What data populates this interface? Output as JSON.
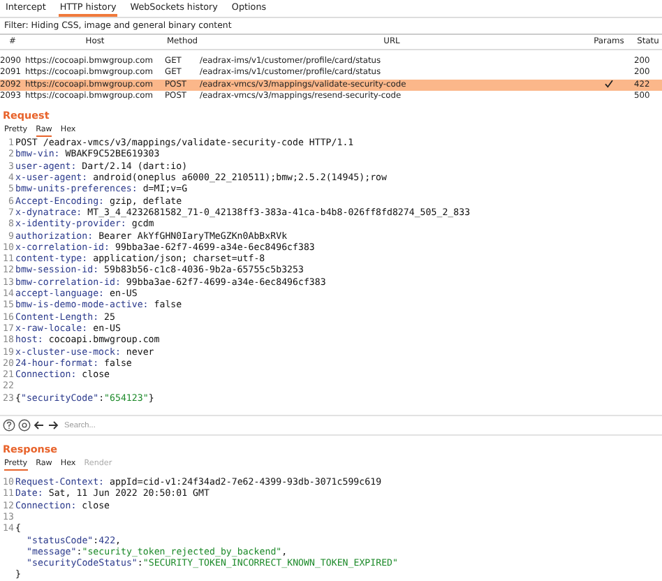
{
  "top_tabs": [
    {
      "label": "Intercept",
      "selected": false
    },
    {
      "label": "HTTP history",
      "selected": true
    },
    {
      "label": "WebSockets history",
      "selected": false
    },
    {
      "label": "Options",
      "selected": false
    }
  ],
  "filter": "Filter: Hiding CSS, image and general binary content",
  "table": {
    "columns": [
      "#",
      "Host",
      "Method",
      "URL",
      "Params",
      "Statu"
    ],
    "rows": [
      {
        "num": "2090",
        "host": "https://cocoapi.bmwgroup.com",
        "method": "GET",
        "url": "/eadrax-ims/v1/customer/profile/card/status",
        "params": false,
        "status": "200",
        "selected": false
      },
      {
        "num": "2091",
        "host": "https://cocoapi.bmwgroup.com",
        "method": "GET",
        "url": "/eadrax-ims/v1/customer/profile/card/status",
        "params": false,
        "status": "200",
        "selected": false
      },
      {
        "num": "2092",
        "host": "https://cocoapi.bmwgroup.com",
        "method": "POST",
        "url": "/eadrax-vmcs/v3/mappings/validate-security-code",
        "params": true,
        "status": "422",
        "selected": true
      },
      {
        "num": "2093",
        "host": "https://cocoapi.bmwgroup.com",
        "method": "POST",
        "url": "/eadrax-vmcs/v3/mappings/resend-security-code",
        "params": false,
        "status": "500",
        "selected": false
      }
    ]
  },
  "request": {
    "title": "Request",
    "tabs": [
      {
        "label": "Pretty",
        "selected": false,
        "disabled": false
      },
      {
        "label": "Raw",
        "selected": true,
        "disabled": false
      },
      {
        "label": "Hex",
        "selected": false,
        "disabled": false
      }
    ],
    "lines": [
      {
        "n": "1",
        "kind": "plain",
        "text": "POST /eadrax-vmcs/v3/mappings/validate-security-code HTTP/1.1"
      },
      {
        "n": "2",
        "kind": "header",
        "name": "bmw-vin:",
        "value": "WBAKF9C52BE619303"
      },
      {
        "n": "3",
        "kind": "header",
        "name": "user-agent:",
        "value": "Dart/2.14 (dart:io)"
      },
      {
        "n": "4",
        "kind": "header",
        "name": "x-user-agent:",
        "value": "android(oneplus a6000_22_210511);bmw;2.5.2(14945);row"
      },
      {
        "n": "5",
        "kind": "header",
        "name": "bmw-units-preferences:",
        "value": "d=MI;v=G"
      },
      {
        "n": "6",
        "kind": "header",
        "name": "Accept-Encoding:",
        "value": "gzip, deflate"
      },
      {
        "n": "7",
        "kind": "header",
        "name": "x-dynatrace:",
        "value": "MT_3_4_4232681582_71-0_42138ff3-383a-41ca-b4b8-026ff8fd8274_505_2_833"
      },
      {
        "n": "8",
        "kind": "header",
        "name": "x-identity-provider:",
        "value": "gcdm"
      },
      {
        "n": "9",
        "kind": "header",
        "name": "authorization:",
        "value": "Bearer AkYfGHN0IaryTMeGZKn0AbBxRVk"
      },
      {
        "n": "10",
        "kind": "header",
        "name": "x-correlation-id:",
        "value": "99bba3ae-62f7-4699-a34e-6ec8496cf383"
      },
      {
        "n": "11",
        "kind": "header",
        "name": "content-type:",
        "value": "application/json; charset=utf-8"
      },
      {
        "n": "12",
        "kind": "header",
        "name": "bmw-session-id:",
        "value": "59b83b56-c1c8-4036-9b2a-65755c5b3253"
      },
      {
        "n": "13",
        "kind": "header",
        "name": "bmw-correlation-id:",
        "value": "99bba3ae-62f7-4699-a34e-6ec8496cf383"
      },
      {
        "n": "14",
        "kind": "header",
        "name": "accept-language:",
        "value": "en-US"
      },
      {
        "n": "15",
        "kind": "header",
        "name": "bmw-is-demo-mode-active:",
        "value": "false"
      },
      {
        "n": "16",
        "kind": "header",
        "name": "Content-Length:",
        "value": "25"
      },
      {
        "n": "17",
        "kind": "header",
        "name": "x-raw-locale:",
        "value": "en-US"
      },
      {
        "n": "18",
        "kind": "header",
        "name": "host:",
        "value": "cocoapi.bmwgroup.com"
      },
      {
        "n": "19",
        "kind": "header",
        "name": "x-cluster-use-mock:",
        "value": "never"
      },
      {
        "n": "20",
        "kind": "header",
        "name": "24-hour-format:",
        "value": "false"
      },
      {
        "n": "21",
        "kind": "header",
        "name": "Connection:",
        "value": "close"
      },
      {
        "n": "22",
        "kind": "empty"
      },
      {
        "n": "23",
        "kind": "body",
        "tokens": [
          {
            "kind": "punct",
            "text": "{"
          },
          {
            "kind": "key",
            "text": "\"securityCode\""
          },
          {
            "kind": "punct",
            "text": ":"
          },
          {
            "kind": "string",
            "text": "\"654123\""
          },
          {
            "kind": "punct",
            "text": "}"
          }
        ]
      }
    ]
  },
  "search": {
    "placeholder": "Search..."
  },
  "response": {
    "title": "Response",
    "tabs": [
      {
        "label": "Pretty",
        "selected": true,
        "disabled": false
      },
      {
        "label": "Raw",
        "selected": false,
        "disabled": false
      },
      {
        "label": "Hex",
        "selected": false,
        "disabled": false
      },
      {
        "label": "Render",
        "selected": false,
        "disabled": true
      }
    ],
    "lines": [
      {
        "n": "10",
        "kind": "header",
        "name": "Request-Context:",
        "value": "appId=cid-v1:24f34ad2-7e62-4399-93db-3071c599c619"
      },
      {
        "n": "11",
        "kind": "header",
        "name": "Date:",
        "value": "Sat, 11 Jun 2022 20:50:01 GMT"
      },
      {
        "n": "12",
        "kind": "header",
        "name": "Connection:",
        "value": "close"
      },
      {
        "n": "13",
        "kind": "empty"
      },
      {
        "n": "14",
        "kind": "body",
        "tokens": [
          {
            "kind": "punct",
            "text": "{"
          }
        ]
      },
      {
        "kind": "nested",
        "tokens": [
          {
            "kind": "key",
            "text": "\"statusCode\""
          },
          {
            "kind": "punct",
            "text": ":"
          },
          {
            "kind": "number",
            "text": "422"
          },
          {
            "kind": "punct",
            "text": ","
          }
        ]
      },
      {
        "kind": "nested",
        "tokens": [
          {
            "kind": "key",
            "text": "\"message\""
          },
          {
            "kind": "punct",
            "text": ":"
          },
          {
            "kind": "string",
            "text": "\"security_token_rejected_by_backend\""
          },
          {
            "kind": "punct",
            "text": ","
          }
        ]
      },
      {
        "kind": "nested",
        "tokens": [
          {
            "kind": "key",
            "text": "\"securityCodeStatus\""
          },
          {
            "kind": "punct",
            "text": ":"
          },
          {
            "kind": "string",
            "text": "\"SECURITY_TOKEN_INCORRECT_KNOWN_TOKEN_EXPIRED\""
          }
        ]
      },
      {
        "kind": "body",
        "tokens": [
          {
            "kind": "punct",
            "text": "}"
          }
        ]
      }
    ]
  }
}
